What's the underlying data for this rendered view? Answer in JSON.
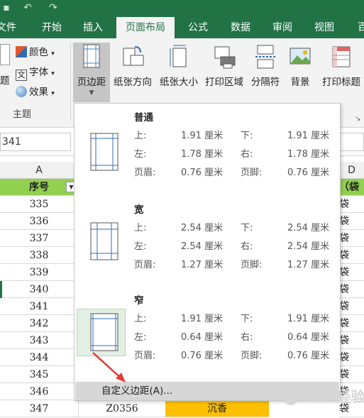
{
  "tabs": [
    {
      "label": "文件",
      "active": false
    },
    {
      "label": "开始",
      "active": false
    },
    {
      "label": "插入",
      "active": false
    },
    {
      "label": "页面布局",
      "active": true
    },
    {
      "label": "公式",
      "active": false
    },
    {
      "label": "数据",
      "active": false
    },
    {
      "label": "审阅",
      "active": false
    },
    {
      "label": "视图",
      "active": false
    },
    {
      "label": "百",
      "active": false
    }
  ],
  "ribbon": {
    "theme_group": {
      "colors": "颜色",
      "fonts": "字体",
      "effects": "效果",
      "themes_cut": "题",
      "group_label": "主题"
    },
    "buttons": {
      "margins": "页边距",
      "orientation": "纸张方向",
      "size": "纸张大小",
      "print_area": "打印区域",
      "breaks": "分隔符",
      "background": "背景",
      "print_titles": "打印标题"
    }
  },
  "namebox": "341",
  "sheet": {
    "col_a": "A",
    "col_d": "D",
    "header_a": "序号",
    "header_d": "（袋",
    "rows": [
      "335",
      "336",
      "337",
      "338",
      "339",
      "340",
      "341",
      "342",
      "343",
      "344",
      "345",
      "346",
      "347"
    ],
    "col_d_value": "袋",
    "last_row_b": "Z0356",
    "last_row_c": "沉香"
  },
  "margins_menu": {
    "presets": [
      {
        "name": "普通",
        "top_label": "上:",
        "top": "1.91 厘米",
        "bottom_label": "下:",
        "bottom": "1.91 厘米",
        "left_label": "左:",
        "left": "1.78 厘米",
        "right_label": "右:",
        "right": "1.78 厘米",
        "header_label": "页眉:",
        "header": "0.76 厘米",
        "footer_label": "页脚:",
        "footer": "0.76 厘米"
      },
      {
        "name": "宽",
        "top_label": "上:",
        "top": "2.54 厘米",
        "bottom_label": "下:",
        "bottom": "2.54 厘米",
        "left_label": "左:",
        "left": "2.54 厘米",
        "right_label": "右:",
        "right": "2.54 厘米",
        "header_label": "页眉:",
        "header": "1.27 厘米",
        "footer_label": "页脚:",
        "footer": "1.27 厘米"
      },
      {
        "name": "窄",
        "top_label": "上:",
        "top": "1.91 厘米",
        "bottom_label": "下:",
        "bottom": "1.91 厘米",
        "left_label": "左:",
        "left": "0.64 厘米",
        "right_label": "右:",
        "right": "0.64 厘米",
        "header_label": "页眉:",
        "header": "0.76 厘米",
        "footer_label": "页脚:",
        "footer": "0.76 厘米"
      }
    ],
    "custom": "自定义边距(A)..."
  },
  "watermark": "Bai 经验",
  "colors": {
    "excel_green": "#217346",
    "header_fill": "#92d050",
    "highlight_orange": "#ffc000",
    "annotation_red": "#e53935"
  }
}
